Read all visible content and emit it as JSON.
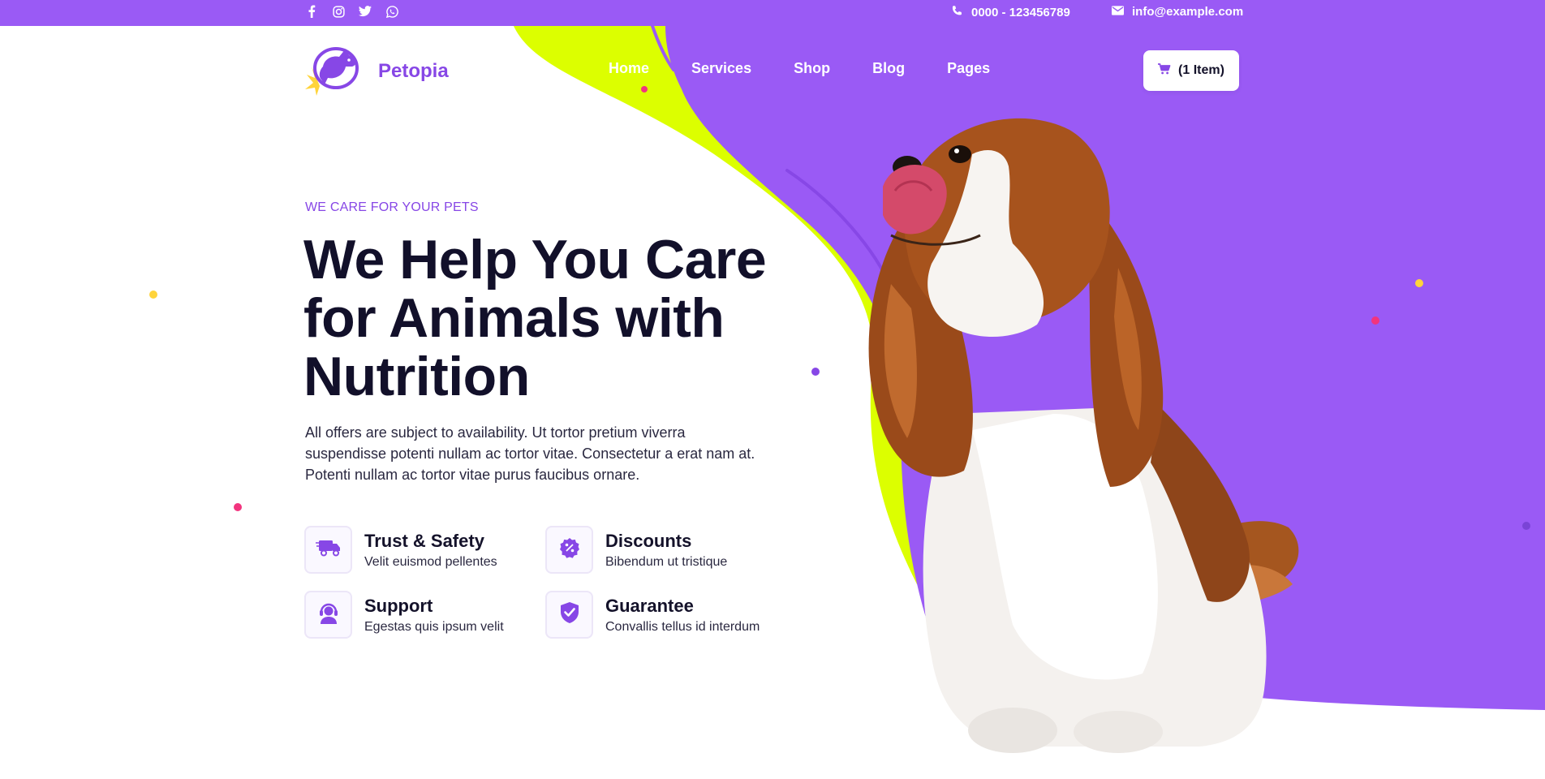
{
  "topbar": {
    "social": [
      {
        "icon": "facebook-icon"
      },
      {
        "icon": "instagram-icon"
      },
      {
        "icon": "twitter-icon"
      },
      {
        "icon": "whatsapp-icon"
      }
    ],
    "phone": "0000 - 123456789",
    "email": "info@example.com"
  },
  "header": {
    "logo_text": "Petopia",
    "nav": [
      "Home",
      "Services",
      "Shop",
      "Blog",
      "Pages"
    ],
    "active_nav": "Home",
    "cart_label": "(1 Item)"
  },
  "hero": {
    "eyebrow": "WE CARE FOR YOUR PETS",
    "headline": "We Help You Care for Animals with Nutrition",
    "lead": "All offers are subject to availability. Ut tortor pretium viverra suspendisse potenti nullam ac tortor vitae. Consectetur a erat nam at. Potenti nullam ac tortor vitae purus faucibus ornare.",
    "features": [
      {
        "title": "Trust & Safety",
        "desc": "Velit euismod pellentes",
        "icon": "delivery-truck-icon"
      },
      {
        "title": "Discounts",
        "desc": "Bibendum ut tristique",
        "icon": "discount-badge-icon"
      },
      {
        "title": "Support",
        "desc": "Egestas quis ipsum velit",
        "icon": "support-agent-icon"
      },
      {
        "title": "Guarantee",
        "desc": "Convallis tellus id interdum",
        "icon": "shield-check-icon"
      }
    ]
  },
  "colors": {
    "brand_purple": "#9a5af5",
    "accent_lime": "#dcff00",
    "dark_text": "#12102a",
    "confetti_pink": "#f2347e",
    "confetti_yellow": "#ffd43b",
    "confetti_purple": "#8747e6"
  }
}
